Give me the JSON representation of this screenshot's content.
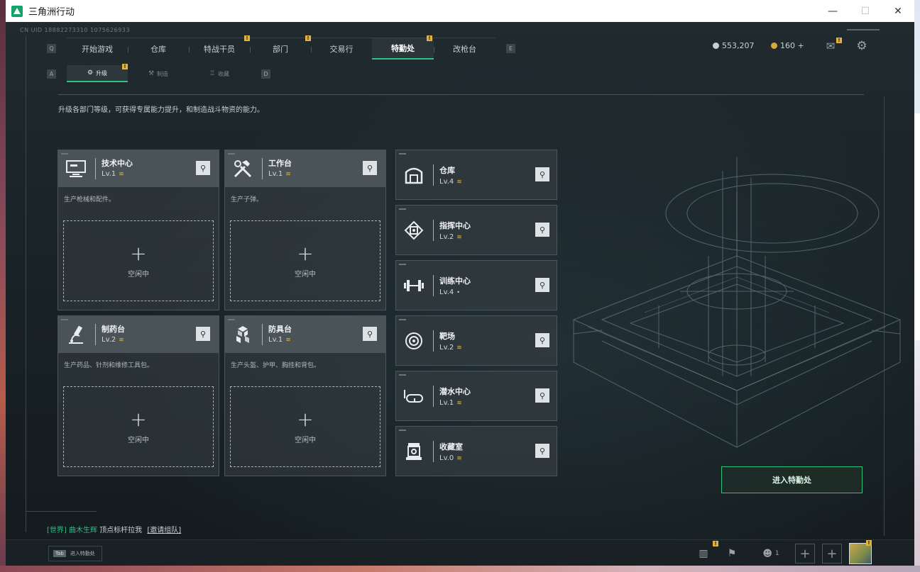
{
  "window": {
    "title": "三角洲行动",
    "controls": {
      "minimize": "—",
      "maximize": "☐",
      "close": "✕"
    }
  },
  "header": {
    "uid": "CN UID 18882273310 1075626933",
    "nav_key_left": "Q",
    "nav_key_right": "E",
    "nav": [
      {
        "label": "开始游戏",
        "badge": ""
      },
      {
        "label": "仓库",
        "badge": ""
      },
      {
        "label": "特战干员",
        "badge": "!"
      },
      {
        "label": "部门",
        "badge": "!"
      },
      {
        "label": "交易行",
        "badge": ""
      },
      {
        "label": "特勤处",
        "badge": "!"
      },
      {
        "label": "改枪台",
        "badge": ""
      }
    ],
    "currency": {
      "silver": "553,207",
      "gold": "160 +"
    },
    "mail_badge": "!"
  },
  "subnav": {
    "key_left": "A",
    "key_right": "D",
    "items": [
      {
        "label": "升级",
        "icon": "⚙",
        "badge": "!"
      },
      {
        "label": "制造",
        "icon": "⚒"
      },
      {
        "label": "收藏",
        "icon": "♖"
      }
    ]
  },
  "description": "升级各部门等级，可获得专属能力提升，和制造战斗物资的能力。",
  "large_cards": [
    {
      "name": "技术中心",
      "level": "Lv.1",
      "desc": "生产枪械和配件。",
      "status": "空闲中",
      "icon": "computer-icon"
    },
    {
      "name": "工作台",
      "level": "Lv.1",
      "desc": "生产子弹。",
      "status": "空闲中",
      "icon": "tools-icon"
    },
    {
      "name": "制药台",
      "level": "Lv.2",
      "desc": "生产药品、针剂和维修工具包。",
      "status": "空闲中",
      "icon": "microscope-icon"
    },
    {
      "name": "防具台",
      "level": "Lv.1",
      "desc": "生产头盔、护甲、胸挂和背包。",
      "status": "空闲中",
      "icon": "armor-boxes-icon"
    }
  ],
  "small_cards": [
    {
      "name": "仓库",
      "level": "Lv.4",
      "icon": "warehouse-icon",
      "chevron": true
    },
    {
      "name": "指挥中心",
      "level": "Lv.2",
      "icon": "command-icon",
      "chevron": true
    },
    {
      "name": "训练中心",
      "level": "Lv.4",
      "icon": "dumbbell-icon",
      "chevron": false
    },
    {
      "name": "靶场",
      "level": "Lv.2",
      "icon": "target-icon",
      "chevron": true
    },
    {
      "name": "潜水中心",
      "level": "Lv.1",
      "icon": "diving-mask-icon",
      "chevron": true
    },
    {
      "name": "收藏室",
      "level": "Lv.0",
      "icon": "collection-icon",
      "chevron": true
    }
  ],
  "enter_button": "进入特勤处",
  "chat": {
    "channel": "[世界]",
    "sender": "曲木生辉",
    "message": "顶点标杆拉我",
    "link": "[邀请组队]"
  },
  "footer": {
    "tab_key": "Tab",
    "tab_label": "进入特勤处",
    "stats_badge": "!",
    "friends_count": "1",
    "avatar_badge": "!"
  },
  "colors": {
    "accent": "#29c47e",
    "badge": "#e2b33a"
  }
}
